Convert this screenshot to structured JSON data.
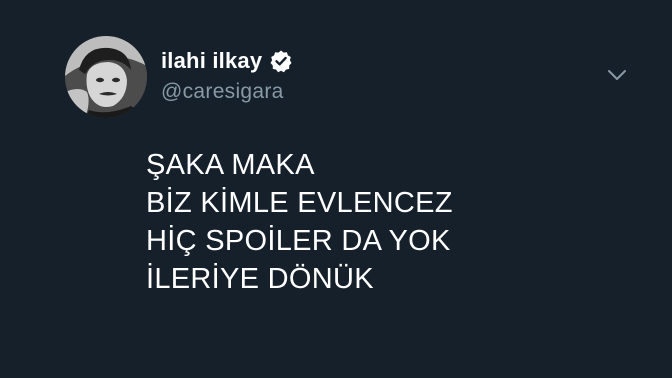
{
  "author": {
    "display_name": "ilahi ilkay",
    "handle": "@caresigara",
    "verified": true,
    "avatar_icon": "profile-photo"
  },
  "tweet": {
    "lines": [
      "ŞAKA MAKA",
      "BİZ KİMLE EVLENCEZ",
      "HİÇ SPOİLER DA YOK",
      "İLERİYE DÖNÜK"
    ]
  },
  "colors": {
    "background": "#15202b",
    "text": "#ffffff",
    "handle": "#8899a6",
    "chevron": "#8899a6"
  },
  "icons": {
    "verified": "verified-badge-icon",
    "menu": "chevron-down-icon"
  }
}
